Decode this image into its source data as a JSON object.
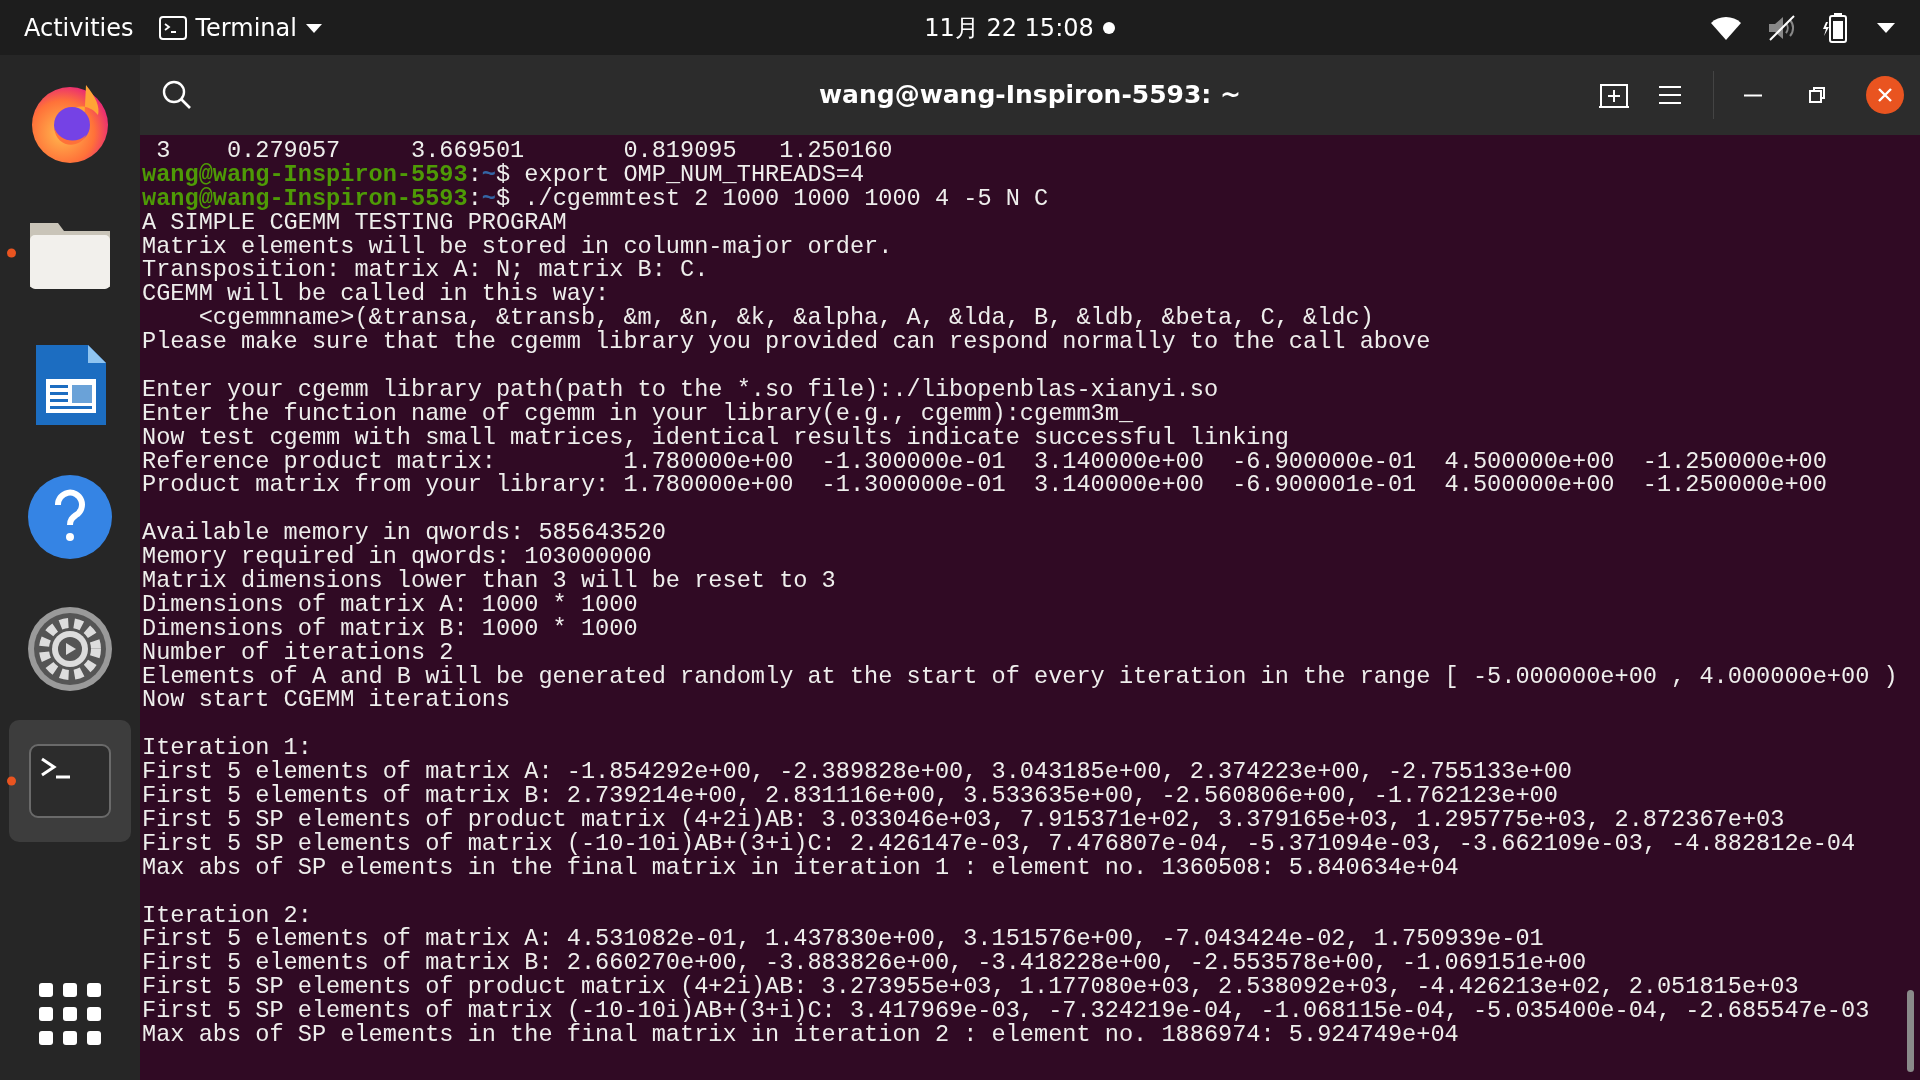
{
  "top_bar": {
    "activities": "Activities",
    "app_menu": {
      "label": "Terminal"
    },
    "clock": "11月 22  15:08"
  },
  "dock": {
    "items": [
      {
        "kind": "firefox",
        "running": false,
        "selected": false
      },
      {
        "kind": "files",
        "running": true,
        "selected": false
      },
      {
        "kind": "writer",
        "running": false,
        "selected": false
      },
      {
        "kind": "help",
        "running": false,
        "selected": false
      },
      {
        "kind": "settings",
        "running": false,
        "selected": false
      },
      {
        "kind": "terminal",
        "running": true,
        "selected": true
      }
    ]
  },
  "terminal": {
    "title": "wang@wang-Inspiron-5593: ~",
    "lines": [
      {
        "kind": "output",
        "text": " 3    0.279057     3.669501       0.819095   1.250160"
      },
      {
        "kind": "prompt",
        "user_host": "wang@wang-Inspiron-5593",
        "separator": ":",
        "path": "~",
        "symbol": "$",
        "command": "export OMP_NUM_THREADS=4"
      },
      {
        "kind": "prompt",
        "user_host": "wang@wang-Inspiron-5593",
        "separator": ":",
        "path": "~",
        "symbol": "$",
        "command": "./cgemmtest 2 1000 1000 1000 4 -5 N C"
      },
      {
        "kind": "output",
        "text": "A SIMPLE CGEMM TESTING PROGRAM"
      },
      {
        "kind": "output",
        "text": "Matrix elements will be stored in column-major order."
      },
      {
        "kind": "output",
        "text": "Transposition: matrix A: N; matrix B: C."
      },
      {
        "kind": "output",
        "text": "CGEMM will be called in this way:"
      },
      {
        "kind": "output",
        "text": "    <cgemmname>(&transa, &transb, &m, &n, &k, &alpha, A, &lda, B, &ldb, &beta, C, &ldc)"
      },
      {
        "kind": "output",
        "text": "Please make sure that the cgemm library you provided can respond normally to the call above"
      },
      {
        "kind": "blank"
      },
      {
        "kind": "output",
        "text": "Enter your cgemm library path(path to the *.so file):./libopenblas-xianyi.so"
      },
      {
        "kind": "output",
        "text": "Enter the function name of cgemm in your library(e.g., cgemm):cgemm3m_"
      },
      {
        "kind": "output",
        "text": "Now test cgemm with small matrices, identical results indicate successful linking"
      },
      {
        "kind": "output",
        "text": "Reference product matrix:         1.780000e+00  -1.300000e-01  3.140000e+00  -6.900000e-01  4.500000e+00  -1.250000e+00"
      },
      {
        "kind": "output",
        "text": "Product matrix from your library: 1.780000e+00  -1.300000e-01  3.140000e+00  -6.900001e-01  4.500000e+00  -1.250000e+00"
      },
      {
        "kind": "blank"
      },
      {
        "kind": "output",
        "text": "Available memory in qwords: 585643520"
      },
      {
        "kind": "output",
        "text": "Memory required in qwords: 103000000"
      },
      {
        "kind": "output",
        "text": "Matrix dimensions lower than 3 will be reset to 3"
      },
      {
        "kind": "output",
        "text": "Dimensions of matrix A: 1000 * 1000"
      },
      {
        "kind": "output",
        "text": "Dimensions of matrix B: 1000 * 1000"
      },
      {
        "kind": "output",
        "text": "Number of iterations 2"
      },
      {
        "kind": "output",
        "text": "Elements of A and B will be generated randomly at the start of every iteration in the range [ -5.000000e+00 , 4.000000e+00 )"
      },
      {
        "kind": "output",
        "text": "Now start CGEMM iterations"
      },
      {
        "kind": "blank"
      },
      {
        "kind": "output",
        "text": "Iteration 1:"
      },
      {
        "kind": "output",
        "text": "First 5 elements of matrix A: -1.854292e+00, -2.389828e+00, 3.043185e+00, 2.374223e+00, -2.755133e+00"
      },
      {
        "kind": "output",
        "text": "First 5 elements of matrix B: 2.739214e+00, 2.831116e+00, 3.533635e+00, -2.560806e+00, -1.762123e+00"
      },
      {
        "kind": "output",
        "text": "First 5 SP elements of product matrix (4+2i)AB: 3.033046e+03, 7.915371e+02, 3.379165e+03, 1.295775e+03, 2.872367e+03"
      },
      {
        "kind": "output",
        "text": "First 5 SP elements of matrix (-10-10i)AB+(3+i)C: 2.426147e-03, 7.476807e-04, -5.371094e-03, -3.662109e-03, -4.882812e-04"
      },
      {
        "kind": "output",
        "text": "Max abs of SP elements in the final matrix in iteration 1 : element no. 1360508: 5.840634e+04"
      },
      {
        "kind": "blank"
      },
      {
        "kind": "output",
        "text": "Iteration 2:"
      },
      {
        "kind": "output",
        "text": "First 5 elements of matrix A: 4.531082e-01, 1.437830e+00, 3.151576e+00, -7.043424e-02, 1.750939e-01"
      },
      {
        "kind": "output",
        "text": "First 5 elements of matrix B: 2.660270e+00, -3.883826e+00, -3.418228e+00, -2.553578e+00, -1.069151e+00"
      },
      {
        "kind": "output",
        "text": "First 5 SP elements of product matrix (4+2i)AB: 3.273955e+03, 1.177080e+03, 2.538092e+03, -4.426213e+02, 2.051815e+03"
      },
      {
        "kind": "output",
        "text": "First 5 SP elements of matrix (-10-10i)AB+(3+i)C: 3.417969e-03, -7.324219e-04, -1.068115e-04, -5.035400e-04, -2.685547e-03"
      },
      {
        "kind": "output",
        "text": "Max abs of SP elements in the final matrix in iteration 2 : element no. 1886974: 5.924749e+04"
      }
    ]
  }
}
